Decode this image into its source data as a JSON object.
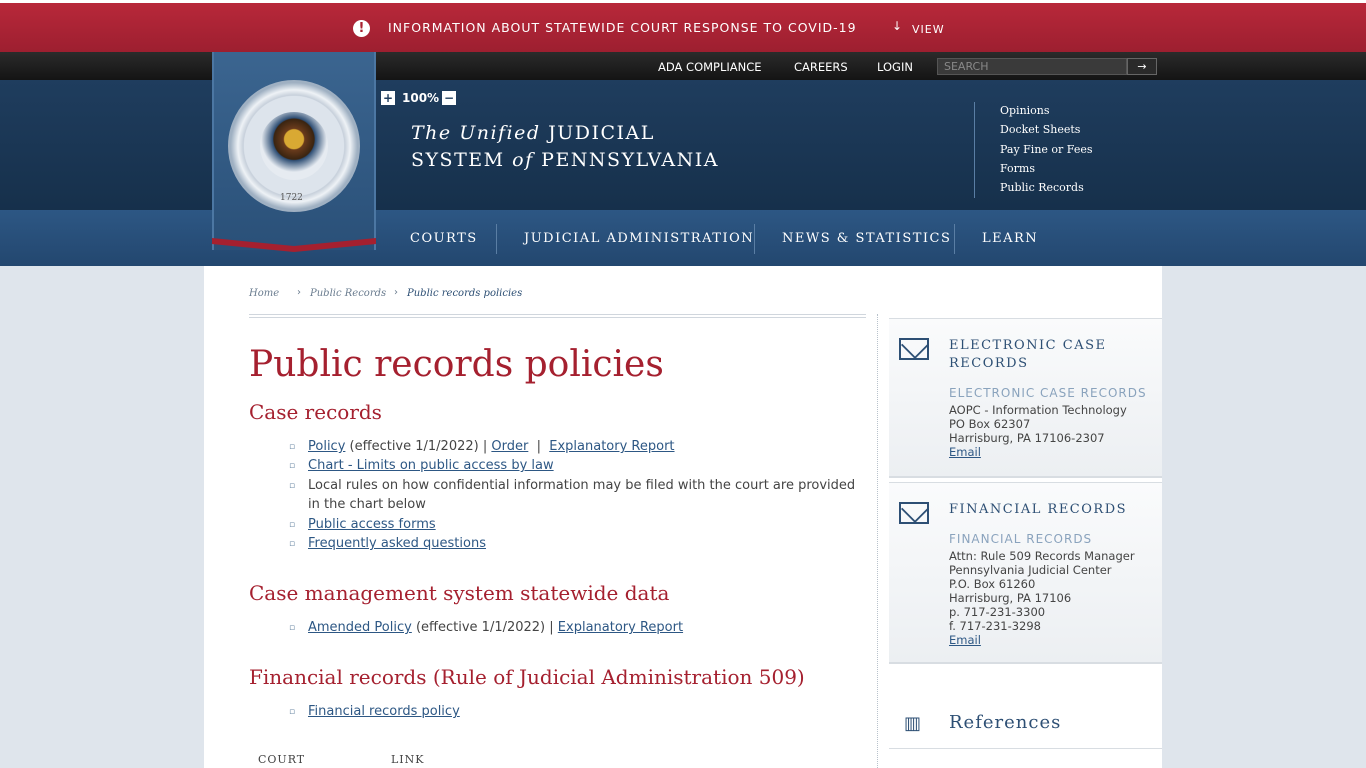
{
  "alert": {
    "icon": "exclamation-icon",
    "message": "INFORMATION ABOUT STATEWIDE COURT RESPONSE TO COVID-19",
    "action": "VIEW"
  },
  "utility": {
    "links": [
      "ADA COMPLIANCE",
      "CAREERS",
      "LOGIN"
    ],
    "search_placeholder": "SEARCH"
  },
  "header": {
    "zoom": "100%",
    "title_line1_italic": "The Unified",
    "title_line1_rest": "JUDICIAL",
    "title_line2_a": "SYSTEM",
    "title_line2_italic": "of",
    "title_line2_b": "PENNSYLVANIA",
    "seal_year": "1722",
    "quick_links": [
      "Opinions",
      "Docket Sheets",
      "Pay Fine or Fees",
      "Forms",
      "Public Records"
    ]
  },
  "nav": [
    "COURTS",
    "JUDICIAL ADMINISTRATION",
    "NEWS & STATISTICS",
    "LEARN"
  ],
  "breadcrumb": [
    "Home",
    "Public Records",
    "Public records policies"
  ],
  "main": {
    "title": "Public records policies",
    "sections": [
      {
        "heading": "Case records",
        "items": {
          "policy": "Policy",
          "policy_note": "(effective 1/1/2022) |",
          "order": "Order",
          "pipe": "|",
          "explanatory": "Explanatory Report",
          "chart": "Chart - Limits on public access by law",
          "local_rules": "Local rules on how confidential information may be filed with the court are provided in the chart below",
          "forms": "Public access forms",
          "faq": "Frequently asked questions"
        }
      },
      {
        "heading": "Case management system statewide data",
        "items": {
          "amended": "Amended Policy",
          "note": "(effective 1/1/2022)  |",
          "explanatory": "Explanatory Report"
        }
      },
      {
        "heading": "Financial records (Rule of Judicial Administration 509)",
        "items": {
          "policy": "Financial records policy"
        }
      }
    ],
    "table_headers": [
      "COURT",
      "LINK"
    ]
  },
  "sidebar": {
    "electronic": {
      "heading_l1": "ELECTRONIC CASE",
      "heading_l2": "RECORDS",
      "subheading": "ELECTRONIC CASE RECORDS",
      "lines": [
        "AOPC - Information Technology",
        "PO Box 62307",
        "Harrisburg, PA 17106-2307"
      ],
      "email": "Email"
    },
    "financial": {
      "heading": "FINANCIAL RECORDS",
      "subheading": "FINANCIAL RECORDS",
      "lines": [
        "Attn: Rule 509 Records Manager",
        "Pennsylvania Judicial Center",
        "P.O. Box 61260",
        "Harrisburg, PA 17106",
        "p. 717-231-3300",
        "f. 717-231-3298"
      ],
      "email": "Email"
    },
    "references": "References"
  }
}
